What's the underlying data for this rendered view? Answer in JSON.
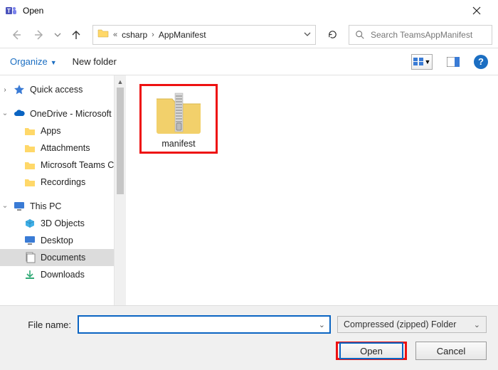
{
  "window": {
    "title": "Open"
  },
  "nav": {
    "crumb1": "csharp",
    "crumb2": "AppManifest",
    "search_placeholder": "Search TeamsAppManifest"
  },
  "toolbar": {
    "organize": "Organize",
    "new_folder": "New folder"
  },
  "sidebar": {
    "quick_access": "Quick access",
    "onedrive": "OneDrive - Microsoft",
    "children": [
      "Apps",
      "Attachments",
      "Microsoft Teams Chat Files",
      "Recordings"
    ],
    "this_pc": "This PC",
    "pc_children": [
      "3D Objects",
      "Desktop",
      "Documents",
      "Downloads"
    ]
  },
  "content": {
    "file_name": "manifest"
  },
  "footer": {
    "filename_label": "File name:",
    "filename_value": "",
    "filter": "Compressed (zipped) Folder",
    "open": "Open",
    "cancel": "Cancel"
  }
}
